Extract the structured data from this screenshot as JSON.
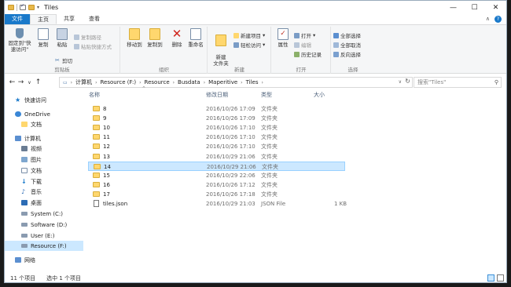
{
  "window": {
    "title": "Tiles"
  },
  "ribbon_tabs": [
    {
      "label": "文件"
    },
    {
      "label": "主页"
    },
    {
      "label": "共享"
    },
    {
      "label": "查看"
    }
  ],
  "ribbon": {
    "clipboard": {
      "label": "剪贴板",
      "pin": "固定到\"快速访问\"",
      "copy": "复制",
      "paste": "粘贴",
      "copy_path": "复制路径",
      "paste_shortcut": "粘贴快捷方式",
      "cut": "剪切"
    },
    "organize": {
      "label": "组织",
      "move_to": "移动到",
      "copy_to": "复制到",
      "delete": "删除",
      "rename": "重命名"
    },
    "new": {
      "label": "新建",
      "new_folder": "新建\n文件夹",
      "new_item": "新建项目",
      "easy_access": "轻松访问"
    },
    "open": {
      "label": "打开",
      "properties": "属性",
      "open": "打开",
      "edit": "编辑",
      "history": "历史记录"
    },
    "select": {
      "label": "选择",
      "select_all": "全部选择",
      "select_none": "全部取消",
      "invert": "反向选择"
    }
  },
  "address": {
    "crumbs": [
      "计算机",
      "Resource (F:)",
      "Resource",
      "Busdata",
      "Maperitive",
      "Tiles"
    ]
  },
  "search": {
    "placeholder": "搜索\"Tiles\""
  },
  "sidebar": {
    "items": [
      {
        "label": "快速访问"
      },
      {
        "label": "OneDrive"
      },
      {
        "label": "文档"
      },
      {
        "label": "计算机"
      },
      {
        "label": "视频"
      },
      {
        "label": "图片"
      },
      {
        "label": "文档"
      },
      {
        "label": "下载"
      },
      {
        "label": "音乐"
      },
      {
        "label": "桌面"
      },
      {
        "label": "System (C:)"
      },
      {
        "label": "Software (D:)"
      },
      {
        "label": "User (E:)"
      },
      {
        "label": "Resource (F:)"
      },
      {
        "label": "网络"
      }
    ]
  },
  "columns": {
    "name": "名称",
    "date": "修改日期",
    "type": "类型",
    "size": "大小"
  },
  "files": [
    {
      "name": "8",
      "date": "2016/10/26 17:09",
      "type": "文件夹",
      "size": ""
    },
    {
      "name": "9",
      "date": "2016/10/26 17:09",
      "type": "文件夹",
      "size": ""
    },
    {
      "name": "10",
      "date": "2016/10/26 17:10",
      "type": "文件夹",
      "size": ""
    },
    {
      "name": "11",
      "date": "2016/10/26 17:10",
      "type": "文件夹",
      "size": ""
    },
    {
      "name": "12",
      "date": "2016/10/26 17:10",
      "type": "文件夹",
      "size": ""
    },
    {
      "name": "13",
      "date": "2016/10/29 21:06",
      "type": "文件夹",
      "size": ""
    },
    {
      "name": "14",
      "date": "2016/10/29 21:06",
      "type": "文件夹",
      "size": ""
    },
    {
      "name": "15",
      "date": "2016/10/29 22:06",
      "type": "文件夹",
      "size": ""
    },
    {
      "name": "16",
      "date": "2016/10/26 17:12",
      "type": "文件夹",
      "size": ""
    },
    {
      "name": "17",
      "date": "2016/10/26 17:18",
      "type": "文件夹",
      "size": ""
    },
    {
      "name": "tiles.json",
      "date": "2016/10/29 21:03",
      "type": "JSON File",
      "size": "1 KB"
    }
  ],
  "status": {
    "count": "11 个项目",
    "selected": "选中 1 个项目"
  },
  "colors": {
    "accent": "#1979ca",
    "selection": "#cce8ff",
    "folder": "#ffd76e"
  }
}
